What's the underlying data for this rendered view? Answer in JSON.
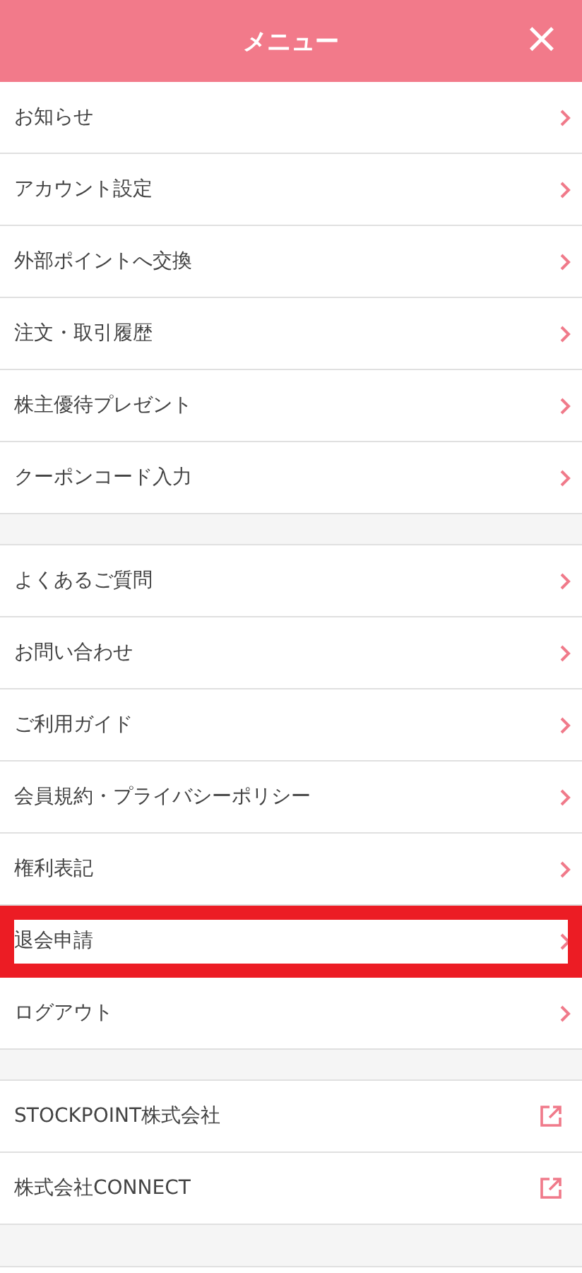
{
  "header": {
    "title": "メニュー",
    "close": "×"
  },
  "groups": [
    {
      "items": [
        {
          "label": "お知らせ",
          "kind": "internal",
          "highlighted": false
        },
        {
          "label": "アカウント設定",
          "kind": "internal",
          "highlighted": false
        },
        {
          "label": "外部ポイントへ交換",
          "kind": "internal",
          "highlighted": false
        },
        {
          "label": "注文・取引履歴",
          "kind": "internal",
          "highlighted": false
        },
        {
          "label": "株主優待プレゼント",
          "kind": "internal",
          "highlighted": false
        },
        {
          "label": "クーポンコード入力",
          "kind": "internal",
          "highlighted": false
        }
      ]
    },
    {
      "items": [
        {
          "label": "よくあるご質問",
          "kind": "internal",
          "highlighted": false
        },
        {
          "label": "お問い合わせ",
          "kind": "internal",
          "highlighted": false
        },
        {
          "label": "ご利用ガイド",
          "kind": "internal",
          "highlighted": false
        },
        {
          "label": "会員規約・プライバシーポリシー",
          "kind": "internal",
          "highlighted": false
        },
        {
          "label": "権利表記",
          "kind": "internal",
          "highlighted": false
        },
        {
          "label": "退会申請",
          "kind": "internal",
          "highlighted": true
        },
        {
          "label": "ログアウト",
          "kind": "internal",
          "highlighted": false
        }
      ]
    },
    {
      "items": [
        {
          "label": "STOCKPOINT株式会社",
          "kind": "external",
          "highlighted": false
        },
        {
          "label": "株式会社CONNECT",
          "kind": "external",
          "highlighted": false
        }
      ]
    }
  ]
}
